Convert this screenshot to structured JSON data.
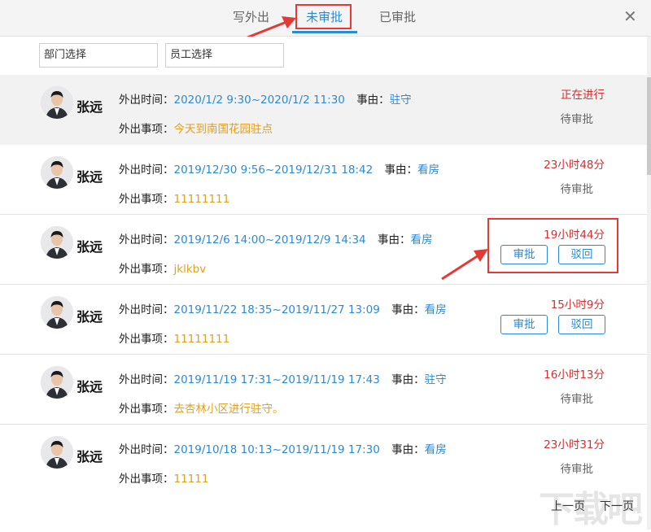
{
  "tabs": [
    "写外出",
    "未审批",
    "已审批"
  ],
  "filters": {
    "department": "部门选择",
    "employee": "员工选择"
  },
  "labels": {
    "time": "外出时间：",
    "reason": "事由：",
    "matter": "外出事项：",
    "approve": "审批",
    "reject": "驳回"
  },
  "records": [
    {
      "name": "张远",
      "time": "2020/1/2 9:30~2020/1/2 11:30",
      "reason": "驻守",
      "matter": "今天到南国花园驻点",
      "remaining": "正在进行",
      "status": "待审批"
    },
    {
      "name": "张远",
      "time": "2019/12/30 9:56~2019/12/31 18:42",
      "reason": "看房",
      "matter": "11111111",
      "remaining": "23小时48分",
      "status": "待审批"
    },
    {
      "name": "张远",
      "time": "2019/12/6 14:00~2019/12/9 14:34",
      "reason": "看房",
      "matter": "jklkbv",
      "remaining": "19小时44分",
      "status": ""
    },
    {
      "name": "张远",
      "time": "2019/11/22 18:35~2019/11/27 13:09",
      "reason": "看房",
      "matter": "11111111",
      "remaining": "15小时9分",
      "status": ""
    },
    {
      "name": "张远",
      "time": "2019/11/19 17:31~2019/11/19 17:43",
      "reason": "驻守",
      "matter": "去杏林小区进行驻守。",
      "remaining": "16小时13分",
      "status": "待审批"
    },
    {
      "name": "张远",
      "time": "2019/10/18 10:13~2019/11/19 17:30",
      "reason": "看房",
      "matter": "11111",
      "remaining": "23小时31分",
      "status": "待审批"
    }
  ],
  "pager": {
    "prev": "上一页",
    "next": "下一页"
  },
  "watermark": "下载吧",
  "colors": {
    "accent": "#2b8ad6",
    "highlight": "#e53935",
    "remaining": "#d32f2f",
    "matter": "#e0a020"
  }
}
